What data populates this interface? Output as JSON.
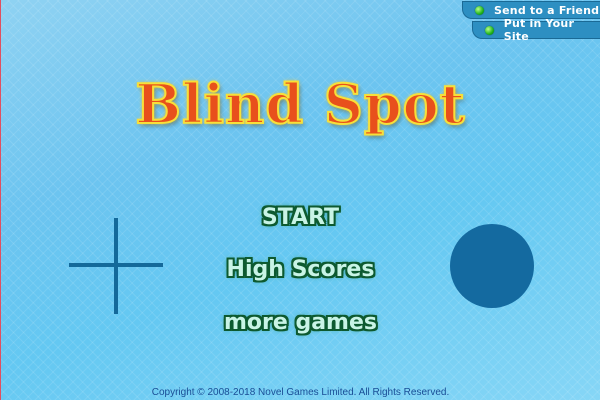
{
  "header": {
    "links": [
      {
        "label": "Send to a Friend"
      },
      {
        "label": "Put in Your Site"
      }
    ]
  },
  "title": "Blind Spot",
  "menu": {
    "start_label": "START",
    "high_scores_label": "High Scores",
    "more_games_label": "more games"
  },
  "footer": {
    "copyright": "Copyright © 2008-2018 Novel Games Limited. All Rights Reserved."
  },
  "icons": {
    "crosshair": "crosshair-icon",
    "target": "circle-target-icon",
    "link_bullet": "green-dot-icon"
  },
  "colors": {
    "background": "#6cc4f0",
    "title_fill": "#e8501c",
    "title_outline": "#f7e03a",
    "menu_text": "#c8f4e6",
    "menu_outline": "#0d5a30",
    "shape_fill": "#14699a",
    "tab_bg": "#2d8fc2",
    "copyright_text": "#1a4e96"
  }
}
